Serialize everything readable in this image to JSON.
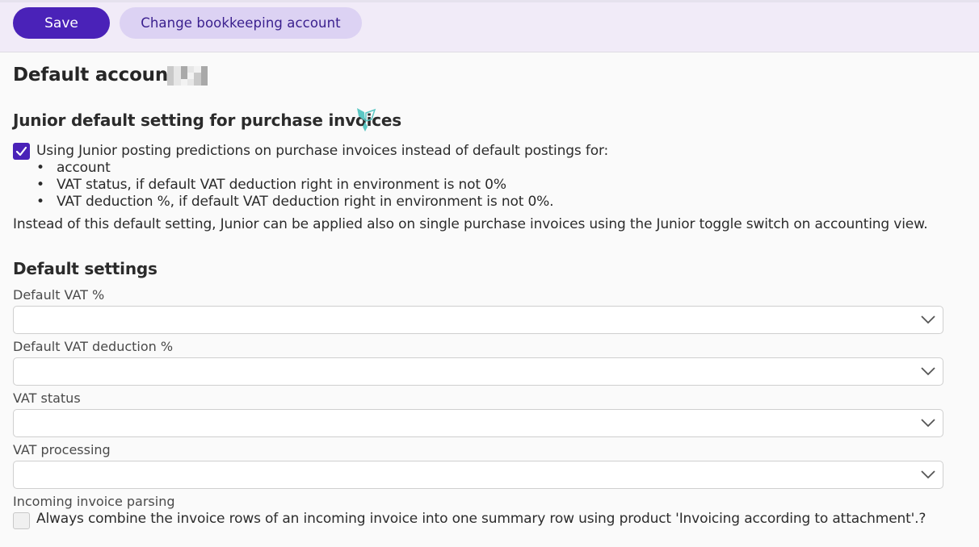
{
  "toolbar": {
    "save_label": "Save",
    "change_label": "Change bookkeeping account"
  },
  "page": {
    "title": "Default accounts:"
  },
  "junior": {
    "heading": "Junior default setting for purchase invoices",
    "checkbox_checked": true,
    "checkbox_label": "Using Junior posting predictions on purchase invoices instead of default postings for:",
    "bullets": [
      "account",
      "VAT status, if default VAT deduction right in environment is not 0%",
      "VAT deduction %, if default VAT deduction right in environment is not 0%."
    ],
    "note": "Instead of this default setting, Junior can be applied also on single purchase invoices using the Junior toggle switch on accounting view."
  },
  "defaults": {
    "heading": "Default settings",
    "fields": [
      {
        "label": "Default VAT %",
        "value": ""
      },
      {
        "label": "Default VAT deduction %",
        "value": ""
      },
      {
        "label": "VAT status",
        "value": ""
      },
      {
        "label": "VAT processing",
        "value": ""
      }
    ],
    "parsing_label": "Incoming invoice parsing",
    "parsing_checkbox_checked": false,
    "parsing_checkbox_label": "Always combine the invoice rows of an incoming invoice into one summary row using product 'Invoicing according to attachment'.?"
  },
  "colors": {
    "accent": "#4a22b8",
    "secondary_button": "#dcd2f3",
    "toolbar_bg": "#f1ebf8",
    "junior_logo": "#5cc8c4"
  },
  "icons": {
    "junior_logo": "junior-logo-icon",
    "checkmark": "checkmark-icon",
    "chevron": "chevron-down-icon"
  }
}
